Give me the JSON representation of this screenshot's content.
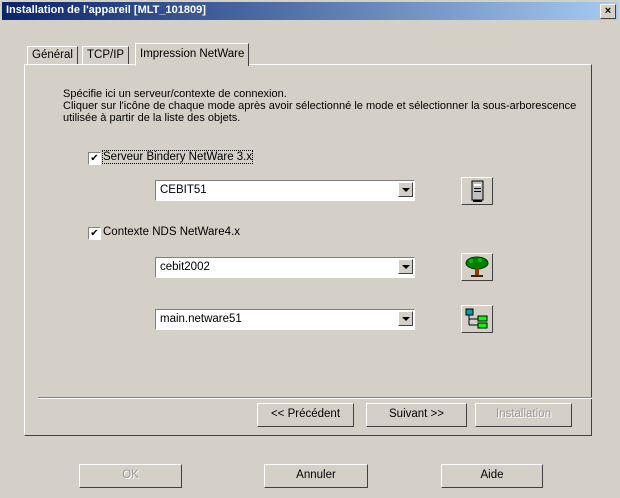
{
  "window": {
    "title": "Installation de l'appareil  [MLT_101809]",
    "close_glyph": "×"
  },
  "tabs": [
    {
      "label": "Général"
    },
    {
      "label": "TCP/IP"
    },
    {
      "label": "Impression NetWare"
    }
  ],
  "description": "Spécifie ici un serveur/contexte de connexion.\nCliquer sur l'icône de chaque mode après avoir sélectionné le mode et sélectionner la sous-arborescence utilisée à partir de la liste des objets.",
  "bindery": {
    "checkbox_label": "Serveur Bindery NetWare 3.x",
    "checked": true,
    "server_value": "CEBIT51",
    "icon": "server-icon"
  },
  "nds": {
    "checkbox_label": "Contexte NDS NetWare4.x",
    "checked": true,
    "tree_value": "cebit2002",
    "tree_icon": "tree-icon",
    "context_value": "main.netware51",
    "context_icon": "hierarchy-icon"
  },
  "wizard_buttons": {
    "previous": "<< Précédent",
    "next": "Suivant >>",
    "install": "Installation"
  },
  "dialog_buttons": {
    "ok": "OK",
    "cancel": "Annuler",
    "help": "Aide"
  }
}
